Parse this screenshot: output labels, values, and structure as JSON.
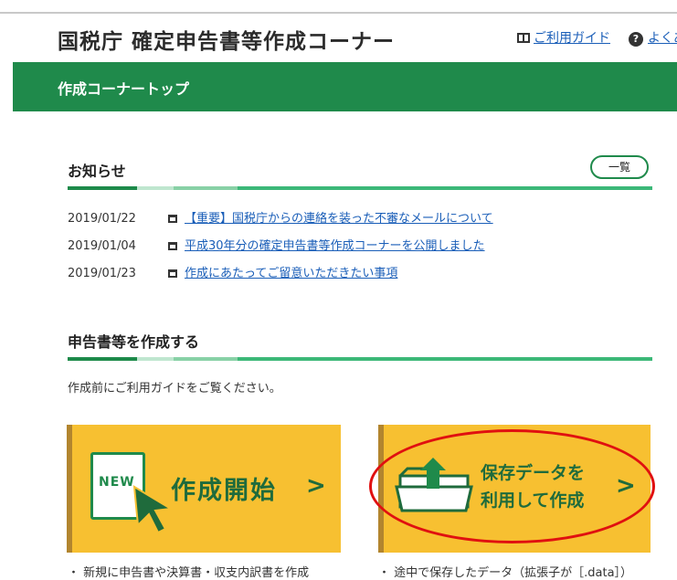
{
  "header": {
    "title": "国税庁 確定申告書等作成コーナー",
    "guide_link": "ご利用ガイド",
    "faq_link": "よくあ"
  },
  "nav": {
    "label": "作成コーナートップ"
  },
  "notices": {
    "title": "お知らせ",
    "list_button": "一覧",
    "items": [
      {
        "date": "2019/01/22",
        "text": "【重要】国税庁からの連絡を装った不審なメールについて"
      },
      {
        "date": "2019/01/04",
        "text": "平成30年分の確定申告書等作成コーナーを公開しました"
      },
      {
        "date": "2019/01/23",
        "text": "作成にあたってご留意いただきたい事項"
      }
    ]
  },
  "create": {
    "title": "申告書等を作成する",
    "note": "作成前にご利用ガイドをご覧ください。",
    "new_badge": "NEW",
    "start_label": "作成開始",
    "saved_label_line1": "保存データを",
    "saved_label_line2": "利用して作成",
    "chevron": ">",
    "bullet1": "・ 新規に申告書や決算書・収支内訳書を作成",
    "bullet2": "・ 途中で保存したデータ（拡張子が［.data］）"
  },
  "colors": {
    "brand_green": "#1f8a4b",
    "card_yellow": "#f7c031",
    "highlight_red": "#e01010",
    "link_blue": "#1a5eb8"
  }
}
